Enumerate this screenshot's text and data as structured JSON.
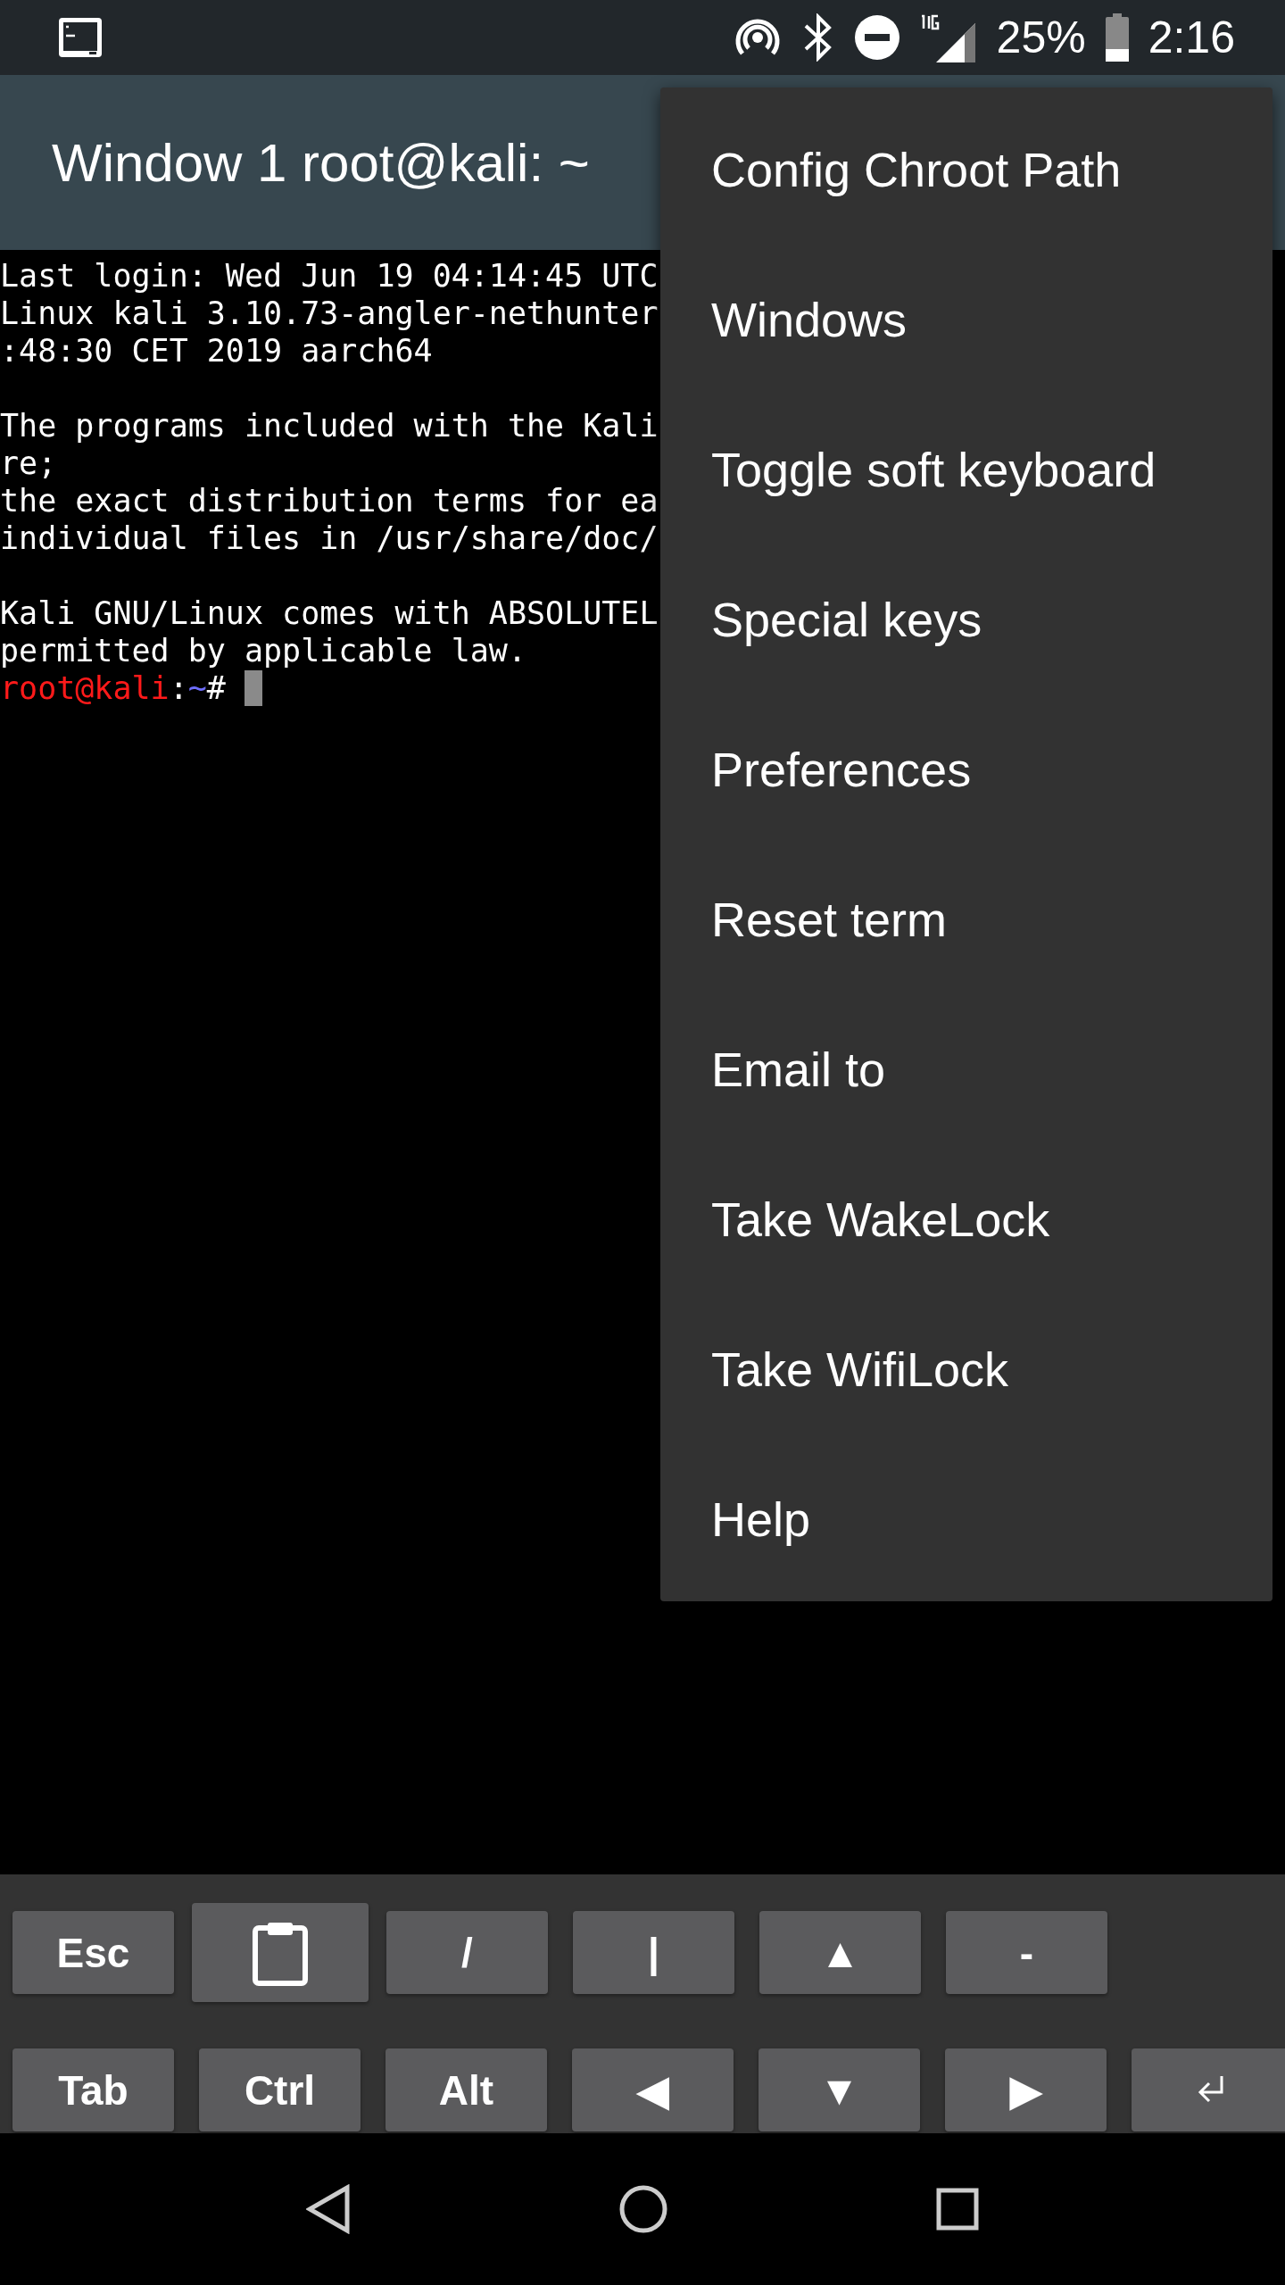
{
  "status_bar": {
    "battery": "25%",
    "time": "2:16"
  },
  "app_bar": {
    "title": "Window 1 root@kali: ~"
  },
  "terminal": {
    "paragraphs": [
      [
        "Last login: Wed Jun 19 04:14:45 UTC",
        "Linux kali 3.10.73-angler-nethunter",
        ":48:30 CET 2019 aarch64"
      ],
      [
        "The programs included with the Kali",
        "re;",
        "the exact distribution terms for ea",
        "individual files in /usr/share/doc/"
      ],
      [
        "Kali GNU/Linux comes with ABSOLUTEL",
        "permitted by applicable law."
      ]
    ],
    "prompt": {
      "user_host": "root@kali",
      "separator": ":",
      "path": "~",
      "symbol": "#"
    }
  },
  "menu": {
    "items": [
      "Config Chroot Path",
      "Windows",
      "Toggle soft keyboard",
      "Special keys",
      "Preferences",
      "Reset term",
      "Email to",
      "Take WakeLock",
      "Take WifiLock",
      "Help"
    ]
  },
  "extra_keys": [
    [
      {
        "kind": "text",
        "label": "Esc"
      },
      {
        "kind": "clipboard"
      },
      {
        "kind": "text",
        "label": "/"
      },
      {
        "kind": "text",
        "label": "|"
      },
      {
        "kind": "text",
        "label": "▲"
      },
      {
        "kind": "text",
        "label": "-"
      }
    ],
    [
      {
        "kind": "text",
        "label": "Tab"
      },
      {
        "kind": "text",
        "label": "Ctrl"
      },
      {
        "kind": "text",
        "label": "Alt"
      },
      {
        "kind": "text",
        "label": "◀"
      },
      {
        "kind": "text",
        "label": "▼"
      },
      {
        "kind": "text",
        "label": "▶"
      },
      {
        "kind": "enter"
      }
    ]
  ]
}
